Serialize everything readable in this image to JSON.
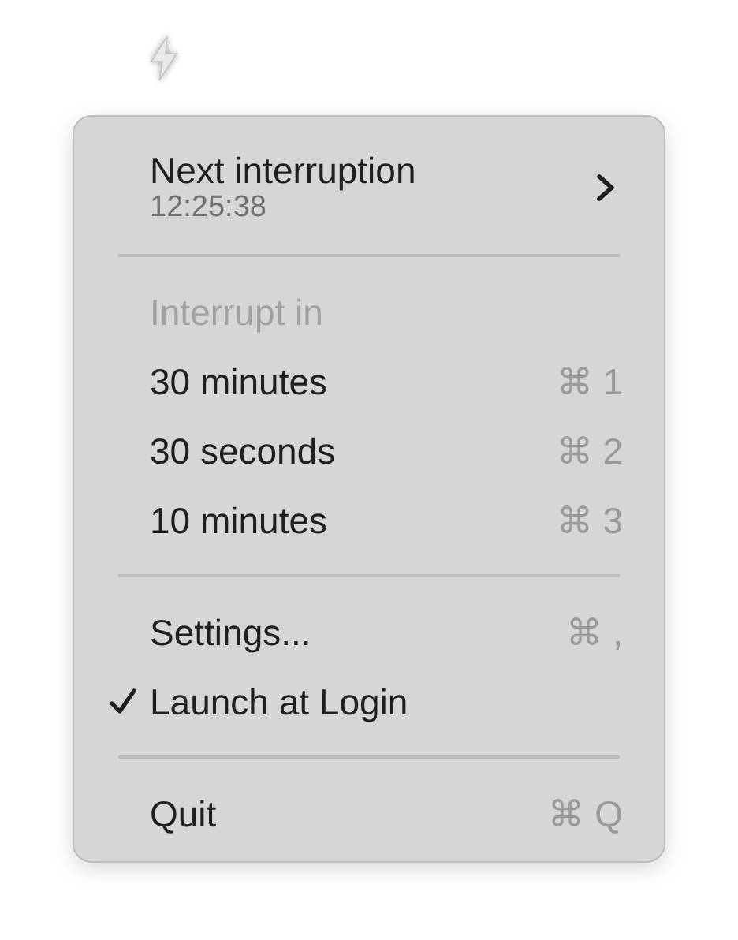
{
  "menu": {
    "sections": [
      {
        "items": [
          {
            "kind": "submenu",
            "label": "Next interruption",
            "detail": "12:25:38"
          }
        ]
      },
      {
        "items": [
          {
            "kind": "header",
            "label": "Interrupt in"
          },
          {
            "kind": "item",
            "label": "30 minutes",
            "shortcut": "⌘ 1",
            "checked": false
          },
          {
            "kind": "item",
            "label": "30 seconds",
            "shortcut": "⌘ 2",
            "checked": false
          },
          {
            "kind": "item",
            "label": "10 minutes",
            "shortcut": "⌘ 3",
            "checked": false
          }
        ]
      },
      {
        "items": [
          {
            "kind": "item",
            "label": "Settings...",
            "shortcut": "⌘ ,",
            "checked": false
          },
          {
            "kind": "item",
            "label": "Launch at Login",
            "checked": true
          }
        ]
      },
      {
        "items": [
          {
            "kind": "item",
            "label": "Quit",
            "shortcut": "⌘ Q",
            "checked": false
          }
        ]
      }
    ]
  }
}
